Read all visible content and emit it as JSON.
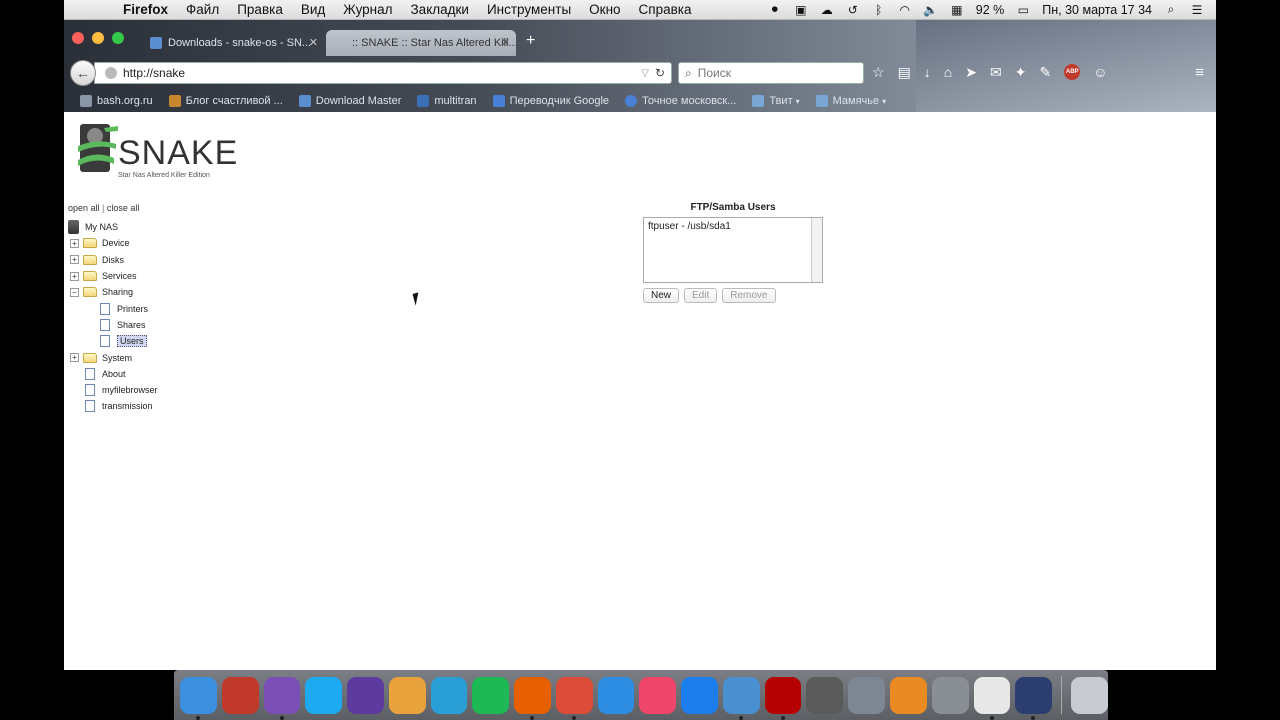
{
  "menubar": {
    "app_name": "Firefox",
    "items": [
      "Файл",
      "Правка",
      "Вид",
      "Журнал",
      "Закладки",
      "Инструменты",
      "Окно",
      "Справка"
    ],
    "status": {
      "battery": "92 %",
      "datetime": "Пн, 30 марта  17 34"
    }
  },
  "tabs": [
    {
      "title": "Downloads - snake-os - SN..."
    },
    {
      "title": ":: SNAKE :: Star Nas Altered Kill..."
    }
  ],
  "urlbar": {
    "url": "http://snake"
  },
  "searchbar": {
    "placeholder": "Поиск"
  },
  "bookmarks": [
    {
      "label": "bash.org.ru",
      "color": "#8a97a8"
    },
    {
      "label": "Блог счастливой ...",
      "color": "#c8872e"
    },
    {
      "label": "Download Master",
      "color": "#5b8ecf"
    },
    {
      "label": "multitran",
      "color": "#3a6fb5"
    },
    {
      "label": "Переводчик Google",
      "color": "#4a7fd6"
    },
    {
      "label": "Точное московск...",
      "color": "#4a7fd6"
    },
    {
      "label": "Твит",
      "color": "#7aa6d6",
      "folder": true
    },
    {
      "label": "Мамячье",
      "color": "#7aa6d6",
      "folder": true
    }
  ],
  "logo": {
    "brand": "SNAKE",
    "tagline": "Star Nas Altered Killer Edition"
  },
  "tree": {
    "open_all": "open all",
    "close_all": "close all",
    "separator": "|",
    "root": "My NAS",
    "items": {
      "device": "Device",
      "disks": "Disks",
      "services": "Services",
      "sharing": "Sharing",
      "printers": "Printers",
      "shares": "Shares",
      "users": "Users",
      "system": "System",
      "about": "About",
      "myfilebrowser": "myfilebrowser",
      "transmission": "transmission"
    }
  },
  "users_panel": {
    "title": "FTP/Samba Users",
    "entries": [
      "ftpuser - /usb/sda1"
    ],
    "buttons": {
      "new": "New",
      "edit": "Edit",
      "remove": "Remove"
    }
  },
  "dock": [
    {
      "name": "finder",
      "color": "#3d8fe0"
    },
    {
      "name": "app-2",
      "color": "#c0392b"
    },
    {
      "name": "viber",
      "color": "#7b4fb5"
    },
    {
      "name": "skype",
      "color": "#1eaaf1"
    },
    {
      "name": "imovie",
      "color": "#5c3a9e"
    },
    {
      "name": "photos",
      "color": "#e8a33d"
    },
    {
      "name": "kodi",
      "color": "#2a9fd6"
    },
    {
      "name": "spotify",
      "color": "#1db954"
    },
    {
      "name": "firefox",
      "color": "#e66000"
    },
    {
      "name": "chrome",
      "color": "#dd4b39"
    },
    {
      "name": "safari",
      "color": "#2d8ee3"
    },
    {
      "name": "itunes",
      "color": "#f0466b"
    },
    {
      "name": "app-store",
      "color": "#1c7ded"
    },
    {
      "name": "tweetbot",
      "color": "#4a8fd0"
    },
    {
      "name": "filezilla",
      "color": "#b40000"
    },
    {
      "name": "evernote",
      "color": "#5a5a5a"
    },
    {
      "name": "launchpad",
      "color": "#7d8793"
    },
    {
      "name": "ibooks",
      "color": "#e98a23"
    },
    {
      "name": "system-preferences",
      "color": "#8a8f96"
    },
    {
      "name": "app-20",
      "color": "#e8e8e8"
    },
    {
      "name": "quicktime",
      "color": "#2c3e70"
    },
    {
      "name": "trash",
      "color": "#c8ccd1"
    }
  ]
}
